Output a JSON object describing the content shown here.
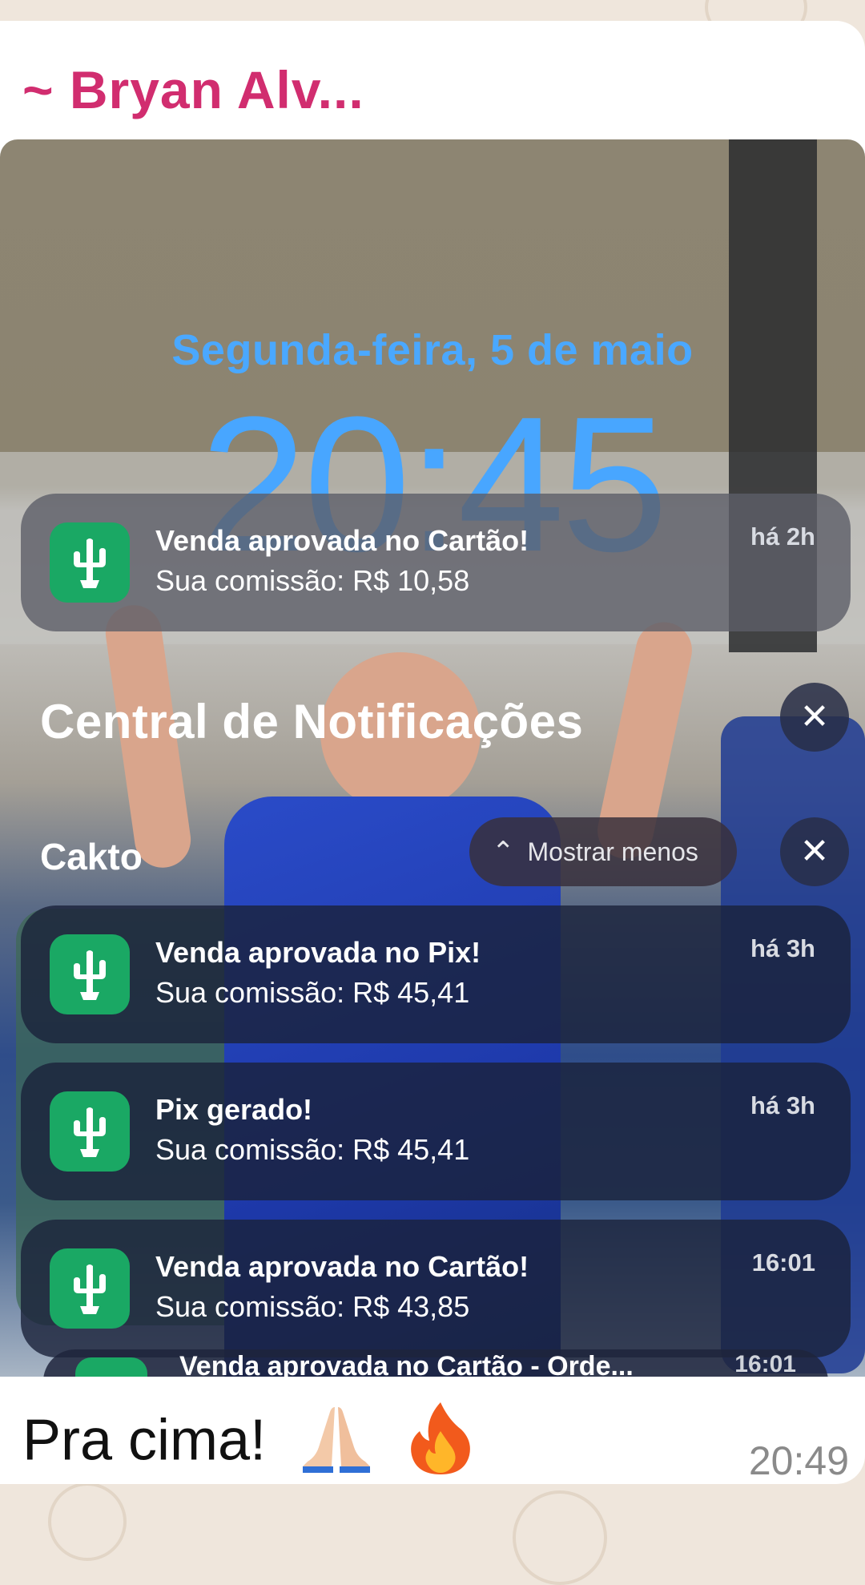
{
  "chat": {
    "sender": "~ Bryan Alv...",
    "caption": "Pra cima!",
    "caption_emojis": [
      "folded-hands-icon",
      "fire-icon"
    ],
    "message_time": "20:49"
  },
  "lockscreen": {
    "date": "Segunda-feira, 5 de maio",
    "time": "20:45",
    "accent_color": "#48a6ff"
  },
  "top_notification": {
    "title": "Venda aprovada no Cartão!",
    "body": "Sua comissão: R$ 10,58",
    "time": "há 2h",
    "icon": "cactus-icon"
  },
  "notification_center": {
    "title": "Central de Notificações",
    "close_glyph": "✕",
    "group": {
      "name": "Cakto",
      "show_less_label": "Mostrar menos",
      "show_less_glyph": "⌃",
      "close_glyph": "✕"
    },
    "notifications": [
      {
        "title": "Venda aprovada no Pix!",
        "body": "Sua comissão: R$ 45,41",
        "time": "há 3h"
      },
      {
        "title": "Pix gerado!",
        "body": "Sua comissão: R$ 45,41",
        "time": "há 3h"
      },
      {
        "title": "Venda aprovada no Cartão!",
        "body": "Sua comissão: R$ 43,85",
        "time": "16:01"
      }
    ],
    "peek": {
      "title": "Venda aprovada no Cartão - Orde...",
      "time": "16:01"
    }
  },
  "colors": {
    "sender": "#d12d6f",
    "app_icon": "#1aa864"
  }
}
